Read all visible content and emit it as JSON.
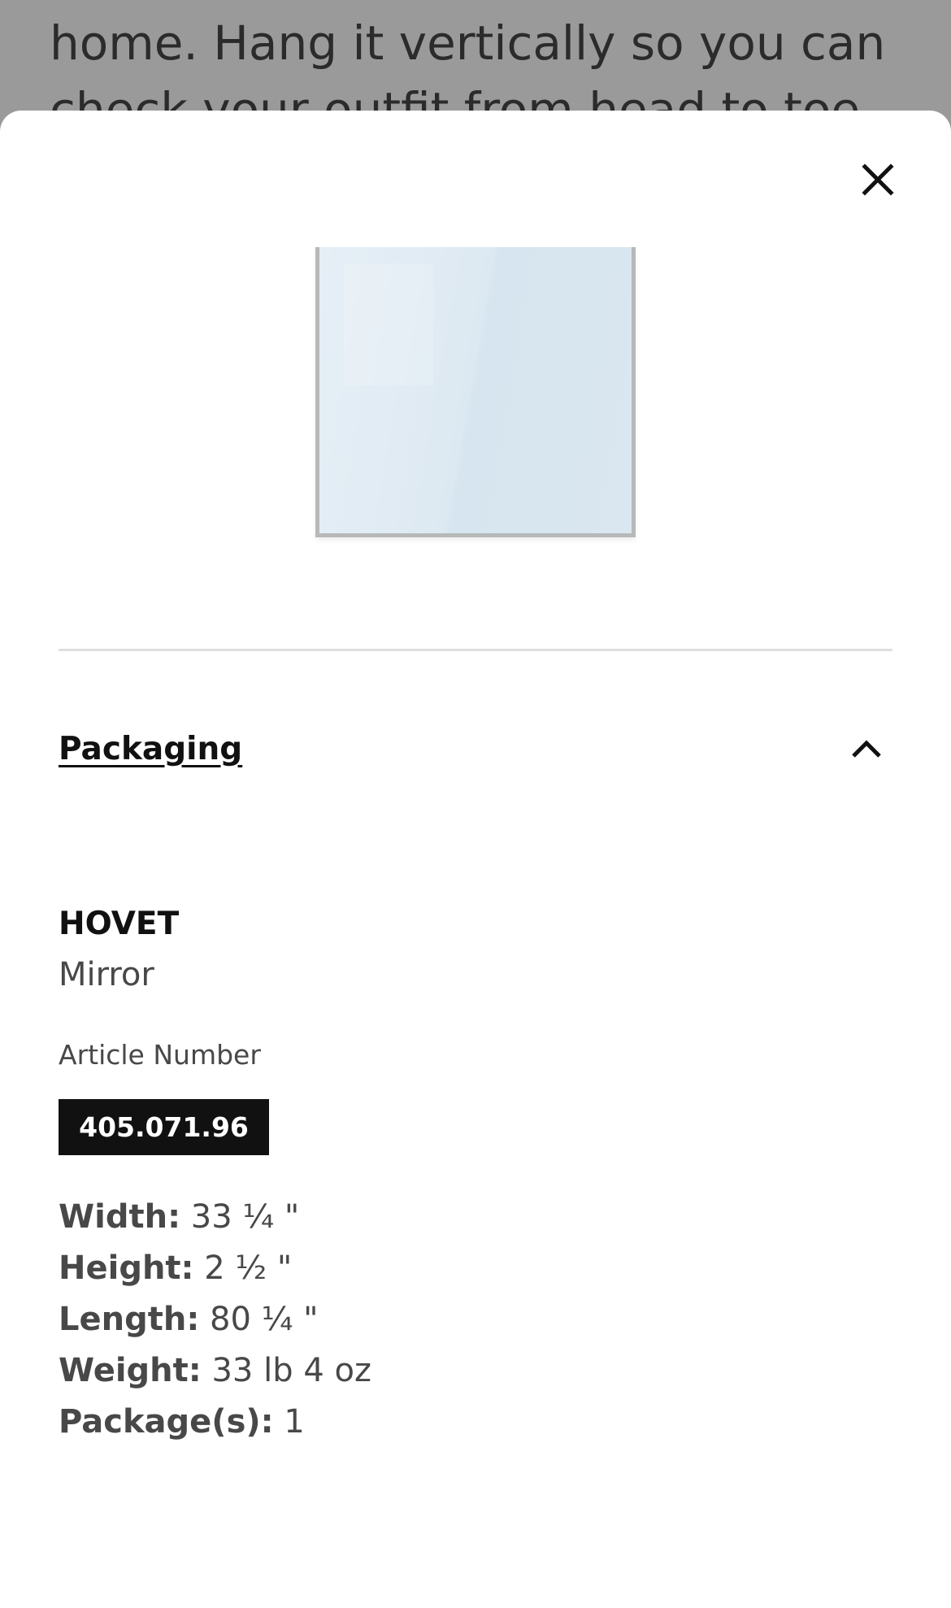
{
  "background": {
    "text_line1": "home. Hang it vertically so you can",
    "text_line2": "check your outfit from head to toe"
  },
  "modal": {
    "close_icon": "close-icon",
    "section": {
      "title": "Packaging",
      "expanded": true,
      "toggle_icon": "chevron-up-icon"
    },
    "product": {
      "name": "HOVET",
      "type": "Mirror",
      "article_label": "Article Number",
      "article_number": "405.071.96"
    },
    "specs": [
      {
        "label": "Width:",
        "value": "33 ¼ \""
      },
      {
        "label": "Height:",
        "value": "2 ½ \""
      },
      {
        "label": "Length:",
        "value": "80 ¼ \""
      },
      {
        "label": "Weight:",
        "value": "33 lb 4 oz"
      },
      {
        "label": "Package(s):",
        "value": "1"
      }
    ]
  },
  "colors": {
    "overlay": "#9a9a9a",
    "sheet": "#ffffff",
    "text_primary": "#111111",
    "text_secondary": "#484848",
    "badge_bg": "#111111",
    "badge_text": "#ffffff",
    "divider": "#dfdfdf"
  }
}
